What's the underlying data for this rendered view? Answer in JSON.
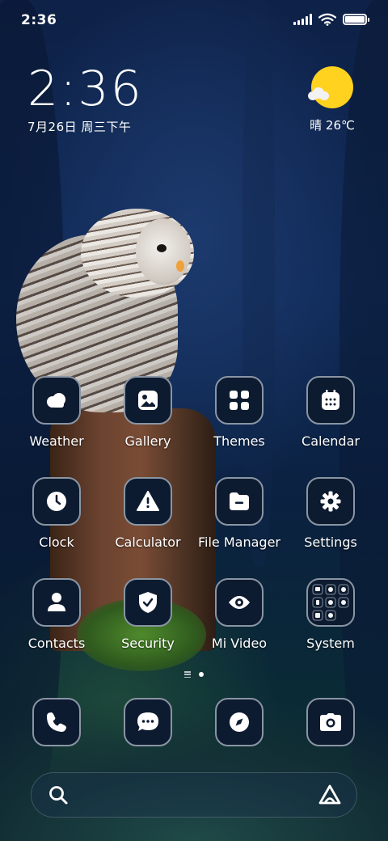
{
  "status_bar": {
    "time": "2:36",
    "battery_level": 1.0
  },
  "clock_widget": {
    "time": "2:36",
    "date": "7月26日 周三下午"
  },
  "weather_widget": {
    "condition_icon": "sun-cloud-icon",
    "text": "晴 26℃"
  },
  "apps": [
    {
      "label": "Weather",
      "icon": "weather-cloud-icon"
    },
    {
      "label": "Gallery",
      "icon": "image-icon"
    },
    {
      "label": "Themes",
      "icon": "grid-icon"
    },
    {
      "label": "Calendar",
      "icon": "calendar-icon"
    },
    {
      "label": "Clock",
      "icon": "clock-icon"
    },
    {
      "label": "Calculator",
      "icon": "warning-icon"
    },
    {
      "label": "File Manager",
      "icon": "folder-icon"
    },
    {
      "label": "Settings",
      "icon": "gear-icon"
    },
    {
      "label": "Contacts",
      "icon": "person-icon"
    },
    {
      "label": "Security",
      "icon": "shield-check-icon"
    },
    {
      "label": "Mi Video",
      "icon": "eye-icon"
    },
    {
      "label": "System",
      "icon": "folder-grid-icon"
    }
  ],
  "dock": [
    {
      "icon": "phone-icon"
    },
    {
      "icon": "message-icon"
    },
    {
      "icon": "compass-icon"
    },
    {
      "icon": "camera-icon"
    }
  ],
  "page_indicator": {
    "current_page": 2,
    "total_pages": 2
  },
  "search_bar": {
    "left_icon": "search-icon",
    "right_icon": "assistant-icon"
  },
  "colors": {
    "icon_bg": "#0d1b30",
    "icon_border": "#8a95a4",
    "sun": "#ffd21f"
  }
}
